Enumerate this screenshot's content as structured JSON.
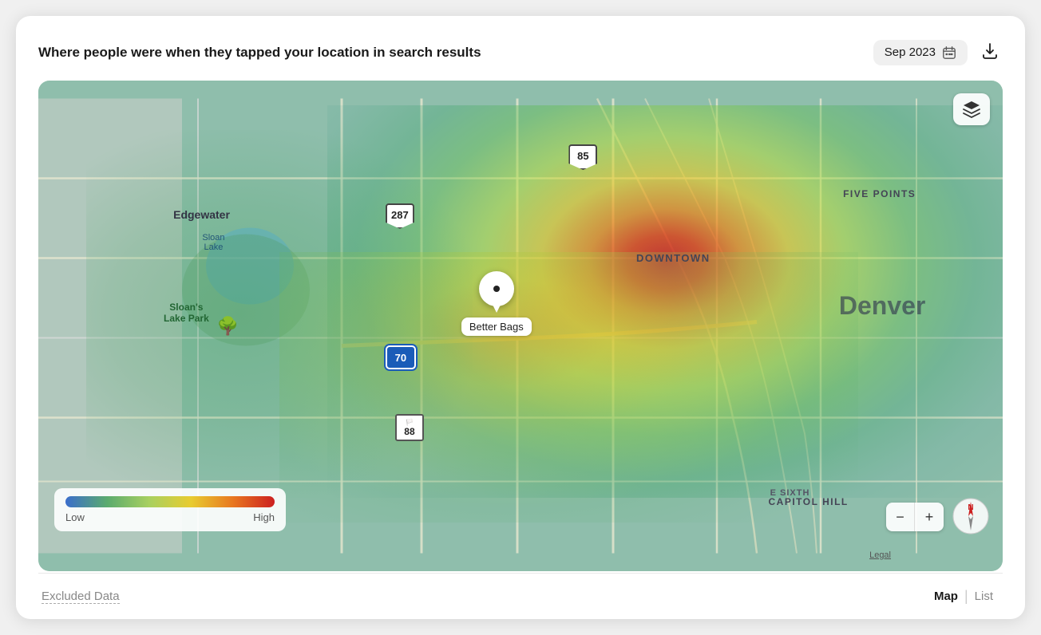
{
  "header": {
    "title": "Where people were when they tapped your location in search results",
    "date_label": "Sep 2023",
    "calendar_icon": "calendar-icon",
    "download_icon": "download-icon"
  },
  "map": {
    "toggle_icon": "map-layers-icon",
    "location_name": "Better Bags",
    "labels": {
      "denver": "Denver",
      "downtown": "DOWNTOWN",
      "five_points": "FIVE POINTS",
      "capitol_hill": "CAPITOL HILL",
      "edgewater": "Edgewater",
      "sloan_lake": "Sloan\nLake",
      "sloans_lake_park": "Sloan's\nLake Park",
      "e_sixth": "E SIXTH"
    },
    "highways": [
      {
        "id": "85",
        "type": "us",
        "top": "14%",
        "left": "56%"
      },
      {
        "id": "287",
        "type": "us",
        "top": "26%",
        "left": "38%"
      },
      {
        "id": "70",
        "type": "interstate",
        "top": "55%",
        "left": "37%"
      },
      {
        "id": "88",
        "type": "state",
        "top": "68%",
        "left": "38%"
      }
    ],
    "legend": {
      "low_label": "Low",
      "high_label": "High"
    },
    "zoom_minus": "−",
    "zoom_plus": "+",
    "legal_label": "Legal"
  },
  "footer": {
    "excluded_data_label": "Excluded Data",
    "view_map_label": "Map",
    "view_list_label": "List",
    "active_view": "map"
  }
}
